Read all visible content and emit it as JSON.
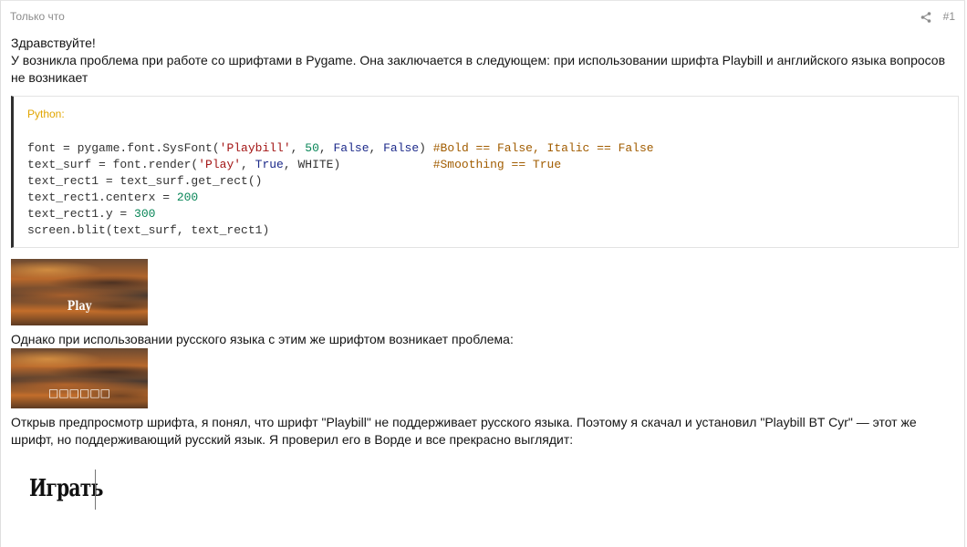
{
  "post": {
    "time": "Только что",
    "number": "#1",
    "greeting": "Здравствуйте!",
    "intro": "У возникла проблема при работе со шрифтами в Pygame. Она заключается в следующем: при использовании шрифта Playbill и английского языка вопросов не возникает",
    "code": {
      "lang": "Python:",
      "lines": [
        [
          {
            "t": "font = pygame.font.SysFont(",
            "c": ""
          },
          {
            "t": "'Playbill'",
            "c": "str"
          },
          {
            "t": ", ",
            "c": ""
          },
          {
            "t": "50",
            "c": "num"
          },
          {
            "t": ", ",
            "c": ""
          },
          {
            "t": "False",
            "c": "kw"
          },
          {
            "t": ", ",
            "c": ""
          },
          {
            "t": "False",
            "c": "kw"
          },
          {
            "t": ") ",
            "c": ""
          },
          {
            "t": "#Bold == False, Italic == False",
            "c": "com"
          }
        ],
        [
          {
            "t": "text_surf = font.render(",
            "c": ""
          },
          {
            "t": "'Play'",
            "c": "str"
          },
          {
            "t": ", ",
            "c": ""
          },
          {
            "t": "True",
            "c": "kw"
          },
          {
            "t": ", WHITE)             ",
            "c": ""
          },
          {
            "t": "#Smoothing == True",
            "c": "com"
          }
        ],
        [
          {
            "t": "text_rect1 = text_surf.get_rect()",
            "c": ""
          }
        ],
        [
          {
            "t": "text_rect1.centerx = ",
            "c": ""
          },
          {
            "t": "200",
            "c": "num"
          }
        ],
        [
          {
            "t": "text_rect1.y = ",
            "c": ""
          },
          {
            "t": "300",
            "c": "num"
          }
        ],
        [
          {
            "t": "screen.blit(text_surf, text_rect1)",
            "c": ""
          }
        ]
      ]
    },
    "image1_text": "Play",
    "middle": "Однако при использовании русского языка с этим же шрифтом возникает проблема:",
    "image2_text": "□□□□□□",
    "outro": "Открыв предпросмотр шрифта, я понял, что шрифт \"Playbill\" не поддерживает русского языка. Поэтому я скачал и установил \"Playbill BT Cyr\" — этот же шрифт, но поддерживающий русский язык. Я проверил его в Ворде и все прекрасно выглядит:",
    "word_sample": "Играть"
  },
  "icons": {
    "share": "share-icon"
  }
}
